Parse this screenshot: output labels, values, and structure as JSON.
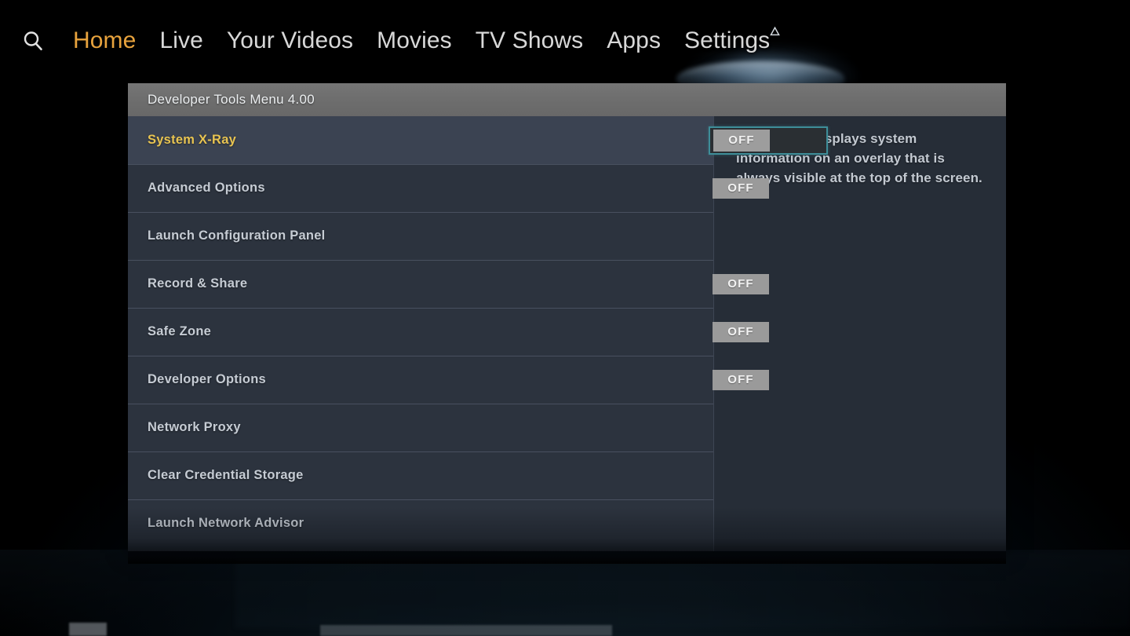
{
  "topnav": {
    "search_icon": "search-icon",
    "items": [
      {
        "label": "Home",
        "active": true
      },
      {
        "label": "Live",
        "active": false
      },
      {
        "label": "Your Videos",
        "active": false
      },
      {
        "label": "Movies",
        "active": false
      },
      {
        "label": "TV Shows",
        "active": false
      },
      {
        "label": "Apps",
        "active": false
      },
      {
        "label": "Settings",
        "active": false,
        "badge_icon": "notification-badge-icon"
      }
    ]
  },
  "dialog": {
    "header_title": "Developer Tools Menu 4.00",
    "menu": [
      {
        "label": "System X-Ray",
        "toggle": "OFF",
        "has_toggle": true,
        "selected": true
      },
      {
        "label": "Advanced Options",
        "toggle": "OFF",
        "has_toggle": true,
        "selected": false
      },
      {
        "label": "Launch Configuration Panel",
        "toggle": "",
        "has_toggle": false,
        "selected": false
      },
      {
        "label": "Record & Share",
        "toggle": "OFF",
        "has_toggle": true,
        "selected": false
      },
      {
        "label": "Safe Zone",
        "toggle": "OFF",
        "has_toggle": true,
        "selected": false
      },
      {
        "label": "Developer Options",
        "toggle": "OFF",
        "has_toggle": true,
        "selected": false
      },
      {
        "label": "Network Proxy",
        "toggle": "",
        "has_toggle": false,
        "selected": false
      },
      {
        "label": "Clear Credential Storage",
        "toggle": "",
        "has_toggle": false,
        "selected": false
      },
      {
        "label": "Launch Network Advisor",
        "toggle": "",
        "has_toggle": false,
        "selected": false
      }
    ],
    "detail_text": "This option displays system information on an overlay that is always visible at the top of the screen."
  },
  "colors": {
    "accent_active_nav": "#e8a33d",
    "selected_item_text": "#e8c451",
    "focus_ring": "#3e8e99",
    "header_bar": "#6d6d6d",
    "row_bg": "#2c333e",
    "row_bg_selected": "#3b4352",
    "detail_bg": "#262d37",
    "toggle_knob": "#9a9a9a"
  }
}
